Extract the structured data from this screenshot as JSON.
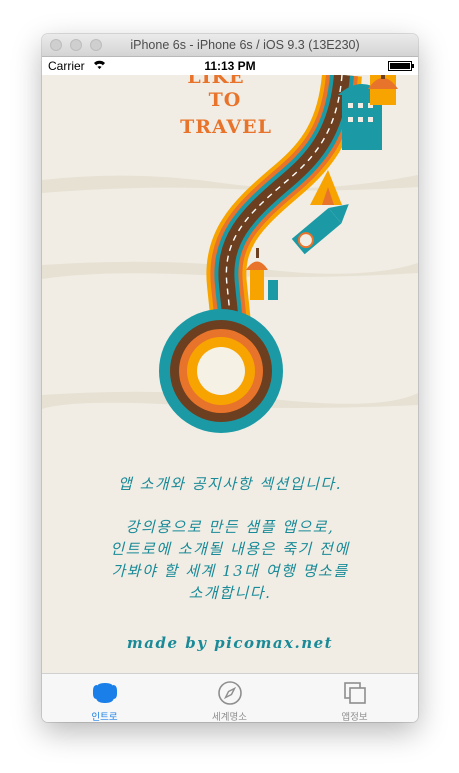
{
  "window": {
    "title": "iPhone 6s - iPhone 6s / iOS 9.3 (13E230)"
  },
  "status_bar": {
    "carrier": "Carrier",
    "time": "11:13 PM"
  },
  "poster": {
    "line1": "LIKE",
    "line2": "TO",
    "line3": "TRAVEL"
  },
  "intro": {
    "headline": "앱 소개와 공지사항 섹션입니다.",
    "body": [
      "강의용으로 만든 샘플 앱으로,",
      "인트로에 소개될 내용은 죽기 전에",
      "가봐야 할 세계 13대 여행 명소를",
      "소개합니다."
    ],
    "credit": "made by picomax.net"
  },
  "tab_bar": {
    "tabs": [
      {
        "label": "인트로",
        "icon": "intro-icon",
        "active": true
      },
      {
        "label": "세계명소",
        "icon": "compass-icon",
        "active": false
      },
      {
        "label": "앱정보",
        "icon": "app-info-icon",
        "active": false
      }
    ]
  },
  "colors": {
    "accent": "#1a7fe8",
    "text_teal": "#1a8a98",
    "poster_orange": "#e8732a",
    "road_brown": "#6b3f1f",
    "background": "#f1ede4"
  }
}
